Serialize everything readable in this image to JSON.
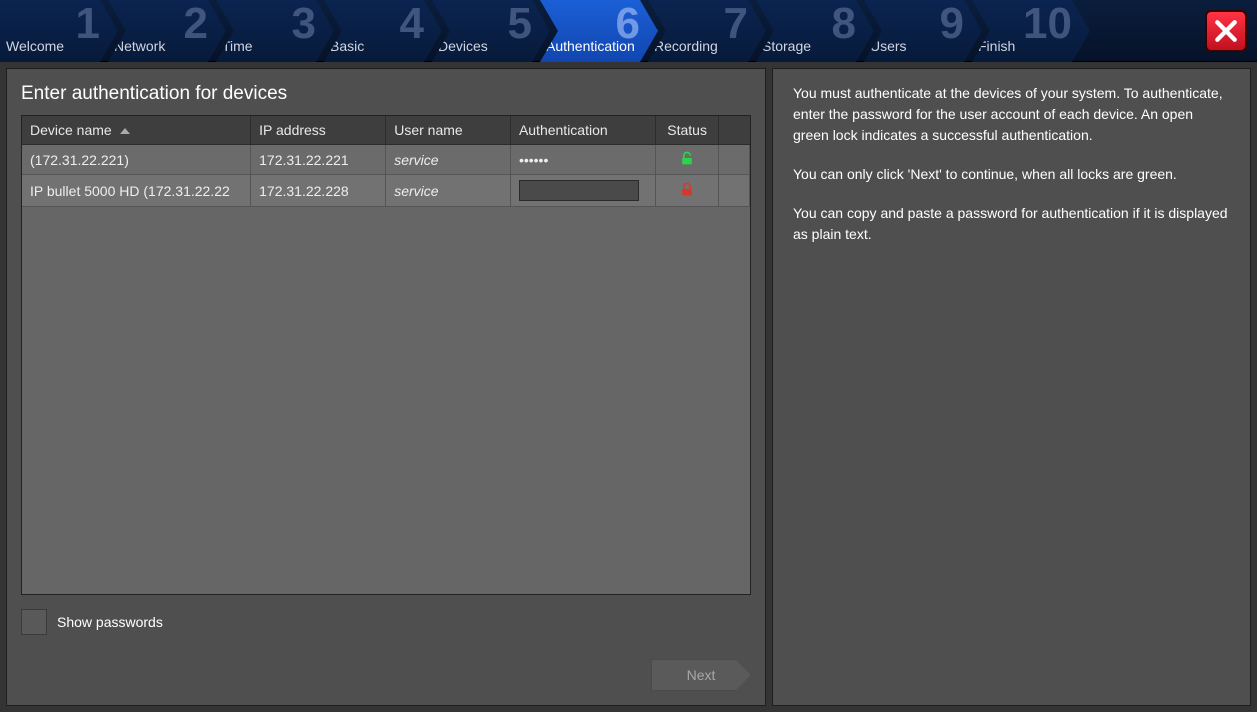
{
  "steps": [
    {
      "num": "1",
      "label": "Welcome"
    },
    {
      "num": "2",
      "label": "Network"
    },
    {
      "num": "3",
      "label": "Time"
    },
    {
      "num": "4",
      "label": "Basic"
    },
    {
      "num": "5",
      "label": "Devices"
    },
    {
      "num": "6",
      "label": "Authentication",
      "active": true
    },
    {
      "num": "7",
      "label": "Recording"
    },
    {
      "num": "8",
      "label": "Storage"
    },
    {
      "num": "9",
      "label": "Users"
    },
    {
      "num": "10",
      "label": "Finish"
    }
  ],
  "title": "Enter authentication for devices",
  "columns": {
    "name": "Device name",
    "ip": "IP address",
    "user": "User name",
    "auth": "Authentication",
    "status": "Status"
  },
  "rows": [
    {
      "name": " (172.31.22.221)",
      "ip": "172.31.22.221",
      "user": "service",
      "auth": "••••••",
      "locked": false
    },
    {
      "name": "IP bullet 5000 HD (172.31.22.22",
      "ip": "172.31.22.228",
      "user": "service",
      "auth": "",
      "locked": true
    }
  ],
  "show_passwords": "Show passwords",
  "next": "Next",
  "help": {
    "p1": "You must authenticate at the devices of your system. To authenticate, enter the password for the user account of each device. An open green lock indicates a successful authentication.",
    "p2": "You can only click 'Next' to continue, when all locks are green.",
    "p3": "You can copy and paste a password for authentication if it is displayed as plain text."
  }
}
